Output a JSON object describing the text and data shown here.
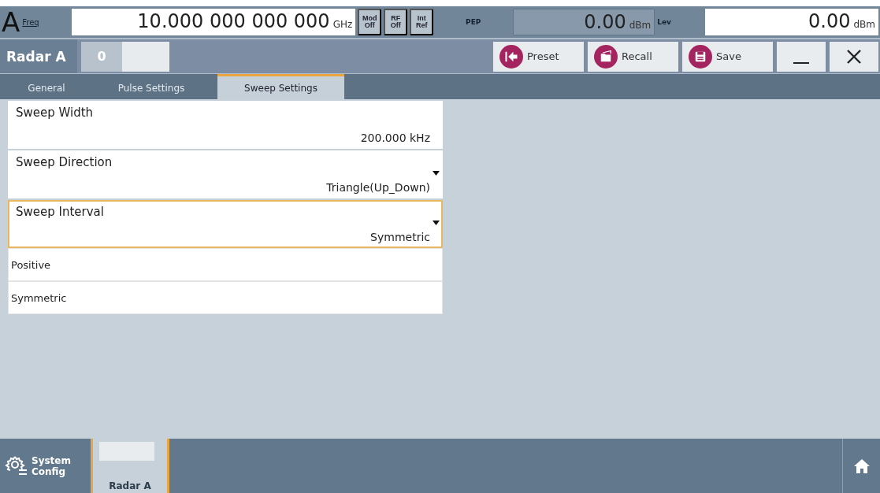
{
  "header": {
    "channel": "A",
    "frequency": {
      "label": "Freq",
      "value": "10.000 000 000 000",
      "unit": "GHz"
    },
    "status_buttons": [
      {
        "line1": "Mod",
        "line2": "Off"
      },
      {
        "line1": "RF",
        "line2": "Off"
      },
      {
        "line1": "Int",
        "line2": "Ref"
      }
    ],
    "pep": {
      "label": "PEP",
      "value": "0.00",
      "unit": "dBm"
    },
    "lev": {
      "label": "Lev",
      "value": "0.00",
      "unit": "dBm"
    }
  },
  "dialog": {
    "title": "Radar A",
    "index": "0",
    "buttons": [
      {
        "kind": "preset",
        "label": "Preset"
      },
      {
        "kind": "recall",
        "label": "Recall"
      },
      {
        "kind": "save",
        "label": "Save"
      },
      {
        "kind": "minimize"
      },
      {
        "kind": "close"
      }
    ]
  },
  "tabs": [
    {
      "label": "General",
      "selected": false
    },
    {
      "label": "Pulse Settings",
      "selected": false
    },
    {
      "label": "Sweep Settings",
      "selected": true
    }
  ],
  "fields": [
    {
      "kind": "number",
      "label": "Sweep Width",
      "value": "200.000  kHz",
      "focused": false
    },
    {
      "kind": "dropdown",
      "label": "Sweep Direction",
      "value": "Triangle(Up_Down)",
      "focused": false
    },
    {
      "kind": "dropdown",
      "label": "Sweep Interval",
      "value": "Symmetric",
      "focused": true
    }
  ],
  "dropdown_options": [
    {
      "label": "Positive"
    },
    {
      "label": "Symmetric"
    }
  ],
  "taskbar": {
    "system_button": "System Config",
    "windows": [
      {
        "label": "Radar A",
        "selected": true
      }
    ]
  }
}
